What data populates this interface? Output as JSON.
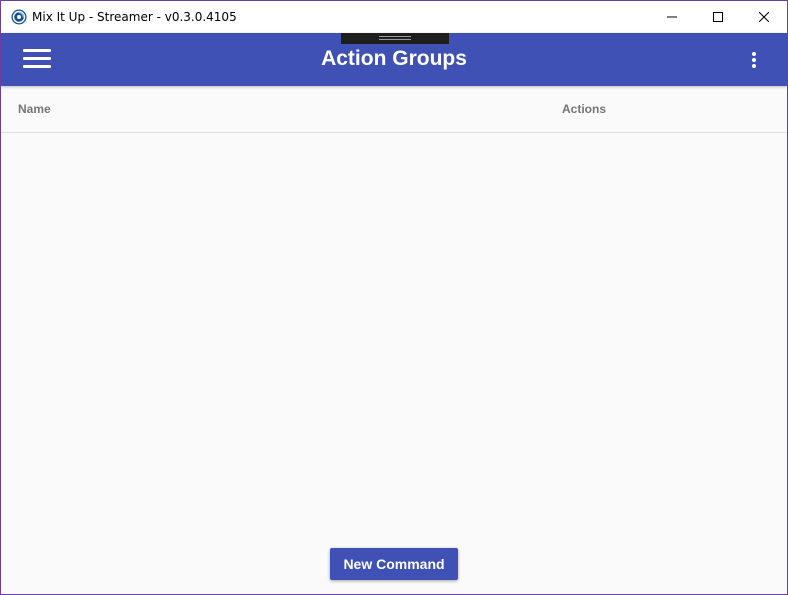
{
  "window": {
    "title": "Mix It Up - Streamer - v0.3.0.4105",
    "app_icon": "mixitup-logo-icon",
    "controls": [
      "minimize-icon",
      "maximize-icon",
      "close-icon"
    ]
  },
  "appbar": {
    "title": "Action Groups",
    "menu_icon": "hamburger-menu-icon",
    "more_icon": "more-vert-icon"
  },
  "table": {
    "columns": [
      "Name",
      "Actions"
    ],
    "rows": []
  },
  "footer": {
    "new_command_label": "New Command"
  },
  "colors": {
    "primary": "#3f51b5",
    "background": "#fafafa",
    "header_text": "#757575",
    "window_border": "#6b3fa0"
  }
}
